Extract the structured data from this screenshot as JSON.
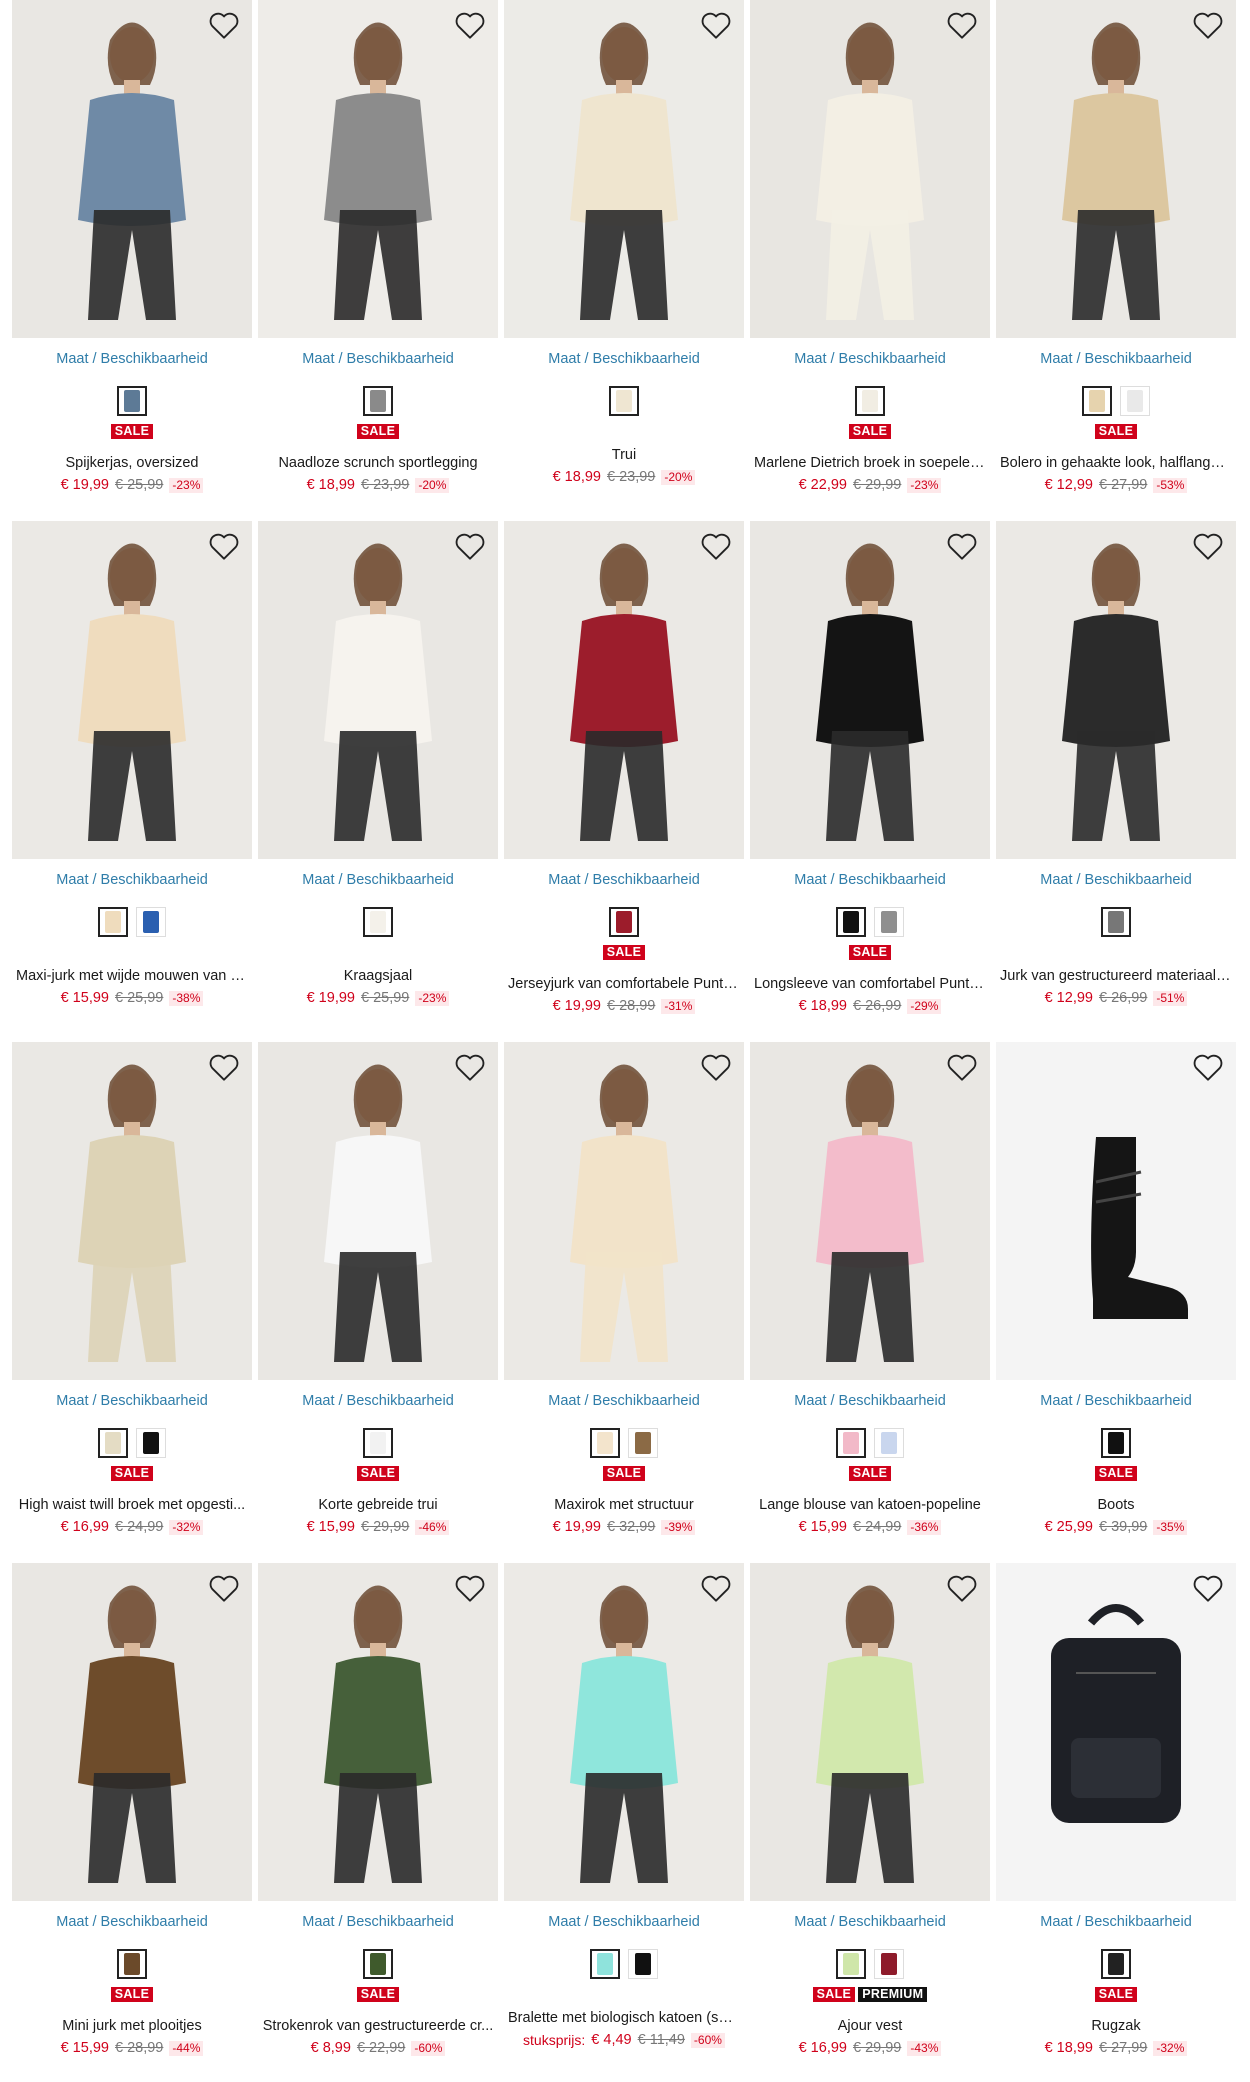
{
  "size_link_label": "Maat / Beschikbaarheid",
  "colors": {
    "sale": "#d0021b",
    "link": "#2f7da9",
    "premium": "#111111"
  },
  "products": [
    {
      "title": "Spijkerjas, oversized",
      "badges": [
        "SALE"
      ],
      "price": "€ 19,99",
      "old_price": "€ 25,99",
      "discount": "-23%",
      "swatches": [
        "#5d7a96"
      ],
      "image": "denim-jacket",
      "fg": "#6f8aa6",
      "bg": "#e9e7e3"
    },
    {
      "title": "Naadloze scrunch sportlegging",
      "badges": [
        "SALE"
      ],
      "price": "€ 18,99",
      "old_price": "€ 23,99",
      "discount": "-20%",
      "swatches": [
        "#8a8a8a"
      ],
      "image": "grey-leggings",
      "fg": "#8c8c8c",
      "bg": "#eeece8"
    },
    {
      "title": "Trui",
      "badges": [],
      "price": "€ 18,99",
      "old_price": "€ 23,99",
      "discount": "-20%",
      "swatches": [
        "#efe6d2"
      ],
      "image": "knit-sweater",
      "fg": "#efe5cf",
      "bg": "#ecebe7"
    },
    {
      "title": "Marlene Dietrich broek in soepele ...",
      "badges": [
        "SALE"
      ],
      "price": "€ 22,99",
      "old_price": "€ 29,99",
      "discount": "-23%",
      "swatches": [
        "#f1ede3"
      ],
      "image": "wide-trousers",
      "fg": "#f3efe4",
      "bg": "#e8e6e1"
    },
    {
      "title": "Bolero in gehaakte look, halflange ...",
      "badges": [
        "SALE"
      ],
      "price": "€ 12,99",
      "old_price": "€ 27,99",
      "discount": "-53%",
      "swatches": [
        "#e6d3ae",
        "#e9e9e9"
      ],
      "image": "crochet-bolero",
      "fg": "#dcc7a0",
      "bg": "#eae8e4"
    },
    {
      "title": "Maxi-jurk met wijde mouwen van st...",
      "badges": [],
      "price": "€ 15,99",
      "old_price": "€ 25,99",
      "discount": "-38%",
      "swatches": [
        "#efdcbd",
        "#2a5fb0"
      ],
      "image": "maxi-dress",
      "fg": "#efdcbe",
      "bg": "#ebe9e5"
    },
    {
      "title": "Kraagsjaal",
      "badges": [],
      "price": "€ 19,99",
      "old_price": "€ 25,99",
      "discount": "-23%",
      "swatches": [
        "#f4f1ea"
      ],
      "image": "scarf",
      "fg": "#f6f3ee",
      "bg": "#e9e7e3"
    },
    {
      "title": "Jerseyjurk van comfortabele Punto...",
      "badges": [
        "SALE"
      ],
      "price": "€ 19,99",
      "old_price": "€ 28,99",
      "discount": "-31%",
      "swatches": [
        "#9c1c2b"
      ],
      "image": "red-dress",
      "fg": "#9c1d2c",
      "bg": "#ebe9e5"
    },
    {
      "title": "Longsleeve van comfortabel Punto ...",
      "badges": [
        "SALE"
      ],
      "price": "€ 18,99",
      "old_price": "€ 26,99",
      "discount": "-29%",
      "swatches": [
        "#111111",
        "#8f8f8f"
      ],
      "image": "black-top",
      "fg": "#141414",
      "bg": "#e9e7e3"
    },
    {
      "title": "Jurk van gestructureerd materiaal ...",
      "badges": [],
      "price": "€ 12,99",
      "old_price": "€ 26,99",
      "discount": "-51%",
      "swatches": [
        "#777777"
      ],
      "image": "floral-dress",
      "fg": "#2b2b2b",
      "bg": "#ebe9e5"
    },
    {
      "title": "High waist twill broek met opgesti...",
      "badges": [
        "SALE"
      ],
      "price": "€ 16,99",
      "old_price": "€ 24,99",
      "discount": "-32%",
      "swatches": [
        "#e4dcc4",
        "#111111"
      ],
      "image": "twill-trousers",
      "fg": "#ddd3b6",
      "bg": "#eae8e4"
    },
    {
      "title": "Korte gebreide trui",
      "badges": [
        "SALE"
      ],
      "price": "€ 15,99",
      "old_price": "€ 29,99",
      "discount": "-46%",
      "swatches": [
        "#f2f2f2"
      ],
      "image": "white-knit",
      "fg": "#f7f7f7",
      "bg": "#e9e7e3"
    },
    {
      "title": "Maxirok met structuur",
      "badges": [
        "SALE"
      ],
      "price": "€ 19,99",
      "old_price": "€ 32,99",
      "discount": "-39%",
      "swatches": [
        "#f3e4cc",
        "#8b6a45"
      ],
      "image": "maxi-skirt",
      "fg": "#f2e3c9",
      "bg": "#ebe9e5"
    },
    {
      "title": "Lange blouse van katoen-popeline",
      "badges": [
        "SALE"
      ],
      "price": "€ 15,99",
      "old_price": "€ 24,99",
      "discount": "-36%",
      "swatches": [
        "#f2b9c8",
        "#c9d6ee"
      ],
      "image": "pink-blouse",
      "fg": "#f3bccb",
      "bg": "#e9e7e3"
    },
    {
      "title": "Boots",
      "badges": [
        "SALE"
      ],
      "price": "€ 25,99",
      "old_price": "€ 39,99",
      "discount": "-35%",
      "swatches": [
        "#111111"
      ],
      "image": "black-boots",
      "fg": "#151515",
      "bg": "#f4f4f4"
    },
    {
      "title": "Mini jurk met plooitjes",
      "badges": [
        "SALE"
      ],
      "price": "€ 15,99",
      "old_price": "€ 28,99",
      "discount": "-44%",
      "swatches": [
        "#6b4a2a"
      ],
      "image": "leopard-dress",
      "fg": "#6e4c2b",
      "bg": "#e9e7e3"
    },
    {
      "title": "Strokenrok van gestructureerde cr...",
      "badges": [
        "SALE"
      ],
      "price": "€ 8,99",
      "old_price": "€ 22,99",
      "discount": "-60%",
      "swatches": [
        "#3f5a2c"
      ],
      "image": "ruffle-skirt",
      "fg": "#46603a",
      "bg": "#ebe9e5"
    },
    {
      "title": "Bralette met biologisch katoen (set...",
      "badges": [],
      "price_label": "stuksprijs:",
      "price": "€ 4,49",
      "old_price": "€ 11,49",
      "discount": "-60%",
      "swatches": [
        "#8fe3dc",
        "#111111"
      ],
      "image": "bralette",
      "fg": "#8fe6dc",
      "bg": "#eceae6"
    },
    {
      "title": "Ajour vest",
      "badges": [
        "SALE",
        "PREMIUM"
      ],
      "price": "€ 16,99",
      "old_price": "€ 29,99",
      "discount": "-43%",
      "swatches": [
        "#cfe6a9",
        "#8e1b2b"
      ],
      "image": "green-cardigan",
      "fg": "#d2e8ad",
      "bg": "#e9e7e3"
    },
    {
      "title": "Rugzak",
      "badges": [
        "SALE"
      ],
      "price": "€ 18,99",
      "old_price": "€ 27,99",
      "discount": "-32%",
      "swatches": [
        "#222222"
      ],
      "image": "backpack",
      "fg": "#1e2026",
      "bg": "#f4f4f4"
    }
  ]
}
